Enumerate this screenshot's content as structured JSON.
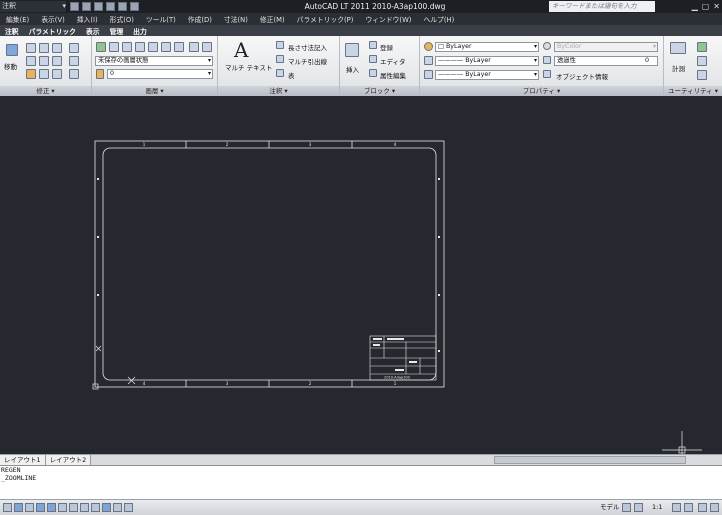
{
  "titlebar": {
    "workspace": "注釈",
    "app_title": "AutoCAD LT 2011    2010-A3ap100.dwg",
    "search_placeholder": "キーワードまたは語句を入力"
  },
  "menu": [
    "編集(E)",
    "表示(V)",
    "挿入(I)",
    "形式(O)",
    "ツール(T)",
    "作成(D)",
    "寸法(N)",
    "修正(M)",
    "パラメトリック(P)",
    "ウィンドウ(W)",
    "ヘルプ(H)"
  ],
  "tabs": [
    "注釈",
    "パラメトリック",
    "表示",
    "管理",
    "出力"
  ],
  "ribbon": {
    "modify": {
      "title": "修正",
      "move_label": "移動"
    },
    "layers": {
      "title": "画層",
      "layer_state": "未保存の画層状態",
      "current_layer": "0"
    },
    "annotation": {
      "title": "注釈",
      "mtext_label": "マルチ テキスト",
      "linear_dim": "長さ寸法記入",
      "mleader": "マルチ引出線",
      "table": "表"
    },
    "block": {
      "title": "ブロック",
      "insert": "挿入",
      "register": "登録",
      "editor": "エディタ",
      "attr_edit": "属性編集"
    },
    "properties": {
      "title": "プロパティ",
      "color": "ByLayer",
      "lineweight": "ByLayer",
      "linetype": "ByLayer",
      "plot_color": "ByColor",
      "transparency_label": "透過性",
      "transparency_value": "0",
      "object_info": "オブジェクト情報"
    },
    "utilities": {
      "title": "ユーティリティ",
      "measure": "計測"
    }
  },
  "drawing": {
    "border_top_numbers": [
      "1",
      "2",
      "3",
      "4"
    ],
    "border_bottom_numbers": [
      "4",
      "3",
      "2",
      "1"
    ],
    "titleblock_code": "2010-A3ap100"
  },
  "layout_tabs": [
    "レイアウト1",
    "レイアウト2"
  ],
  "command_history": [
    "REGEN",
    "_ZOOMLINE"
  ],
  "status": {
    "model_label": "モデル",
    "scale": "1:1"
  }
}
